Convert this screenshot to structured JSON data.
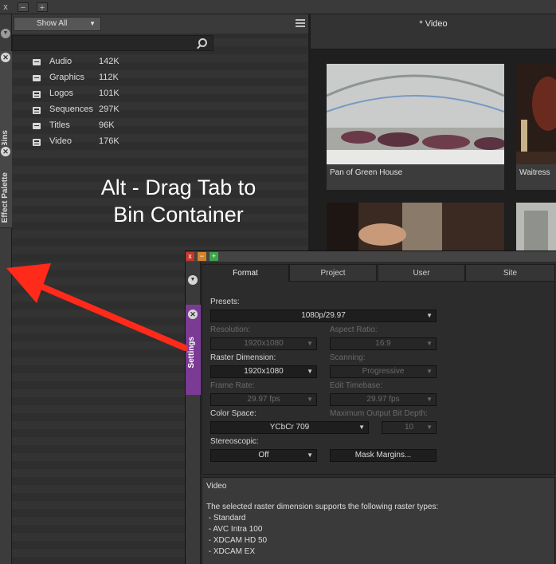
{
  "top_strip": {
    "close": "x",
    "minimize": "−",
    "add": "+"
  },
  "left_strip": {
    "tabs": [
      {
        "label": "Bins"
      },
      {
        "label": "Effect Palette"
      }
    ]
  },
  "bins": {
    "filter": {
      "value": "Show All"
    },
    "items": [
      {
        "name": "Audio",
        "size": "142K",
        "icon": "bin-icon"
      },
      {
        "name": "Graphics",
        "size": "112K",
        "icon": "bin-icon"
      },
      {
        "name": "Logos",
        "size": "101K",
        "icon": "open-bin-icon"
      },
      {
        "name": "Sequences",
        "size": "297K",
        "icon": "open-bin-icon"
      },
      {
        "name": "Titles",
        "size": "96K",
        "icon": "bin-icon"
      },
      {
        "name": "Video",
        "size": "176K",
        "icon": "open-bin-icon"
      }
    ]
  },
  "annotation": {
    "line1": "Alt - Drag Tab to",
    "line2": "Bin Container"
  },
  "video_panel": {
    "title": "* Video",
    "clips": [
      {
        "label": "Pan of Green House"
      },
      {
        "label": "Waitress"
      },
      {
        "label": ""
      },
      {
        "label": ""
      }
    ]
  },
  "settings_window": {
    "buttons": {
      "close": "x",
      "minimize": "−",
      "maximize": "+"
    },
    "side_tab": "Settings",
    "tabs": [
      "Format",
      "Project",
      "User",
      "Site"
    ],
    "active_tab": "Format",
    "fields": {
      "presets": {
        "label": "Presets:",
        "value": "1080p/29.97"
      },
      "resolution": {
        "label": "Resolution:",
        "value": "1920x1080"
      },
      "aspect_ratio": {
        "label": "Aspect Ratio:",
        "value": "16:9"
      },
      "raster_dimension": {
        "label": "Raster Dimension:",
        "value": "1920x1080"
      },
      "scanning": {
        "label": "Scanning:",
        "value": "Progressive"
      },
      "frame_rate": {
        "label": "Frame Rate:",
        "value": "29.97 fps"
      },
      "edit_timebase": {
        "label": "Edit Timebase:",
        "value": "29.97 fps"
      },
      "color_space": {
        "label": "Color Space:",
        "value": "YCbCr 709"
      },
      "max_output_bit_depth": {
        "label": "Maximum Output Bit Depth:",
        "value": "10"
      },
      "stereoscopic": {
        "label": "Stereoscopic:",
        "value": "Off"
      },
      "mask_margins": {
        "label": "Mask Margins..."
      }
    },
    "info": {
      "title": "Video",
      "lines": [
        "The selected raster dimension supports the following raster types:",
        " - Standard",
        " - AVC Intra 100",
        " - XDCAM HD 50",
        " - XDCAM EX"
      ]
    }
  },
  "colors": {
    "accent_purple": "#7b3a94",
    "arrow_red": "#ff2a1a",
    "close_red": "#c0392b",
    "minimize_orange": "#d4842a",
    "maximize_green": "#3fa34d"
  }
}
